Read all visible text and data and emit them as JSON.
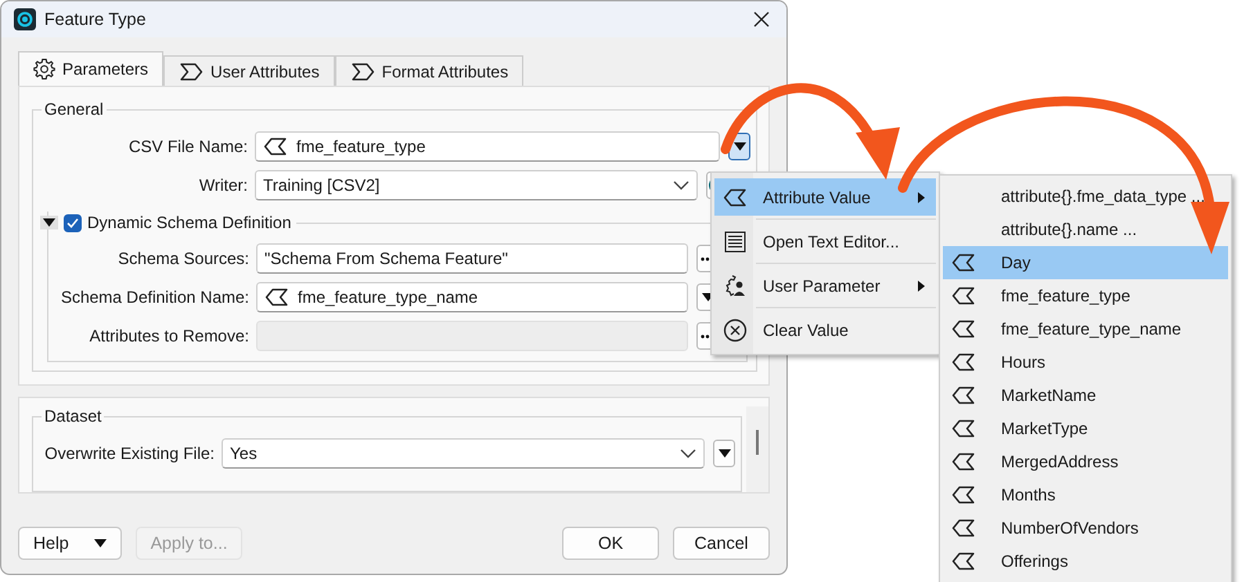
{
  "window": {
    "title": "Feature Type"
  },
  "tabs": [
    {
      "label": "Parameters",
      "selected": true
    },
    {
      "label": "User Attributes",
      "selected": false
    },
    {
      "label": "Format Attributes",
      "selected": false
    }
  ],
  "general": {
    "title": "General",
    "fields": [
      {
        "label": "CSV File Name:",
        "value": "fme_feature_type",
        "kind": "attribute_dropdown",
        "button_pressed": true
      },
      {
        "label": "Writer:",
        "value": "Training [CSV2]",
        "kind": "select_circle"
      }
    ]
  },
  "dynamic_schema": {
    "title": "Dynamic Schema Definition",
    "checked": true,
    "expanded": true,
    "fields": [
      {
        "label": "Schema Sources:",
        "value": "\"Schema From Schema Feature\"",
        "kind": "text_ellipsis",
        "button_pressed": false
      },
      {
        "label": "Schema Definition Name:",
        "value": "fme_feature_type_name",
        "kind": "attribute_dropdown",
        "button_pressed": false
      },
      {
        "label": "Attributes to Remove:",
        "kind": "disabled_ellipsis",
        "button_pressed": false
      }
    ]
  },
  "dataset": {
    "title": "Dataset",
    "fields": [
      {
        "label": "Overwrite Existing File:",
        "value": "Yes",
        "kind": "select_dropdown",
        "button_pressed": false
      }
    ]
  },
  "buttons": [
    {
      "label": "Help",
      "has_menu": true,
      "disabled": false
    },
    {
      "label": "Apply to...",
      "has_menu": false,
      "disabled": true
    },
    {
      "label": "OK",
      "has_menu": false,
      "disabled": false
    },
    {
      "label": "Cancel",
      "has_menu": false,
      "disabled": false
    }
  ],
  "context_menu": {
    "items": [
      {
        "label": "Attribute Value",
        "submenu": true,
        "selected": true
      },
      {
        "label": "Open Text Editor...",
        "submenu": false,
        "selected": false
      },
      {
        "label": "User Parameter",
        "submenu": true,
        "selected": false
      },
      {
        "label": "Clear Value",
        "submenu": false,
        "selected": false
      }
    ]
  },
  "submenu": {
    "items": [
      {
        "label": "attribute{}.fme_data_type ...",
        "attribute": false,
        "selected": false
      },
      {
        "label": "attribute{}.name ...",
        "attribute": false,
        "selected": false
      },
      {
        "label": "Day",
        "attribute": true,
        "selected": true
      },
      {
        "label": "fme_feature_type",
        "attribute": true,
        "selected": false
      },
      {
        "label": "fme_feature_type_name",
        "attribute": true,
        "selected": false
      },
      {
        "label": "Hours",
        "attribute": true,
        "selected": false
      },
      {
        "label": "MarketName",
        "attribute": true,
        "selected": false
      },
      {
        "label": "MarketType",
        "attribute": true,
        "selected": false
      },
      {
        "label": "MergedAddress",
        "attribute": true,
        "selected": false
      },
      {
        "label": "Months",
        "attribute": true,
        "selected": false
      },
      {
        "label": "NumberOfVendors",
        "attribute": true,
        "selected": false
      },
      {
        "label": "Offerings",
        "attribute": true,
        "selected": false
      }
    ]
  }
}
